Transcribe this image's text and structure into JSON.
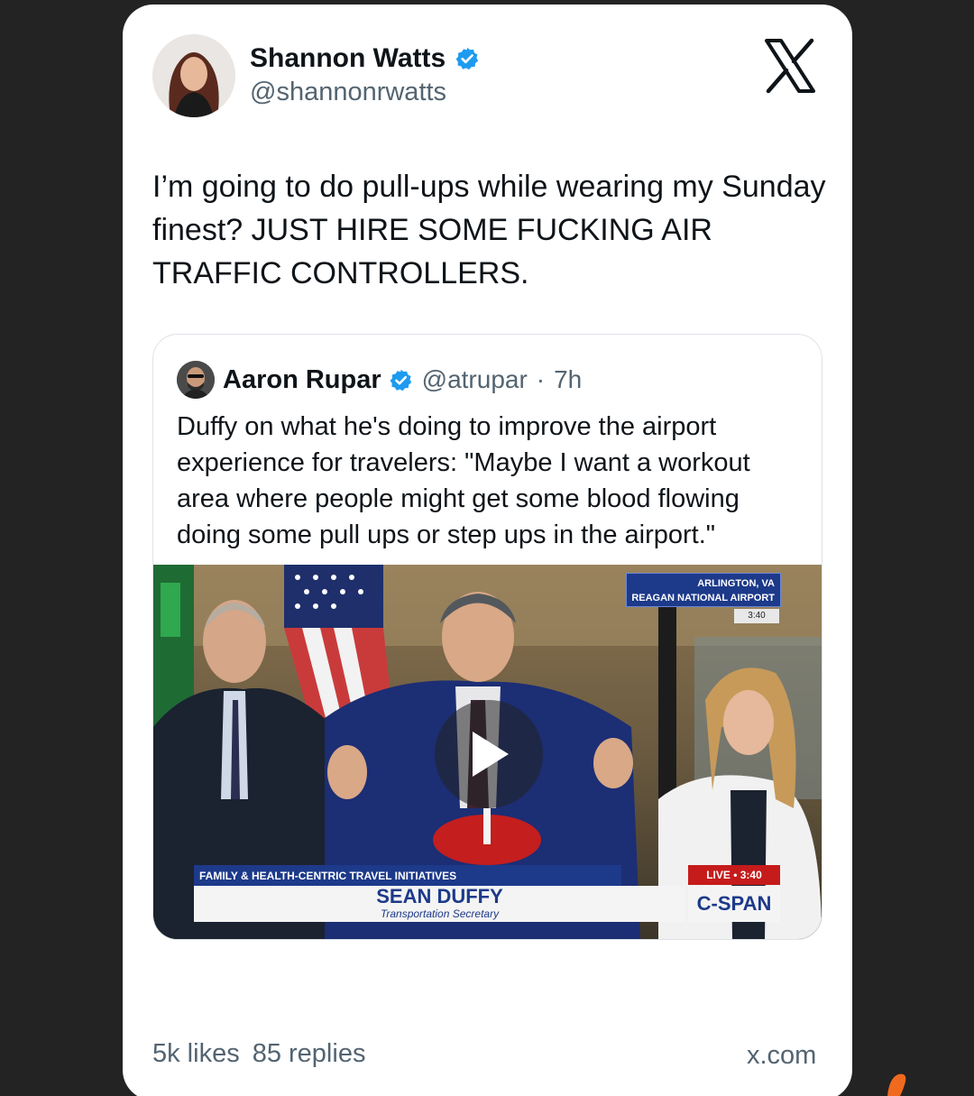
{
  "tweet": {
    "author_name": "Shannon Watts",
    "author_handle": "@shannonrwatts",
    "text": "I’m going to do pull-ups while wearing my Sunday finest? JUST HIRE SOME FUCKING AIR TRAFFIC CONTROLLERS.",
    "verified": true,
    "platform_icon": "x-logo-icon"
  },
  "quote": {
    "author_name": "Aaron Rupar",
    "author_handle": "@atrupar",
    "separator": "·",
    "time": "7h",
    "text": "Duffy on what he's doing to improve the airport experience for travelers: \"Maybe I want a workout area where people might get some blood flowing doing some pull ups or step ups in the airport.\"",
    "verified": true
  },
  "video": {
    "location_line1": "ARLINGTON, VA",
    "location_line2": "REAGAN NATIONAL AIRPORT",
    "location_time": "3:40",
    "lower_third_topic": "FAMILY & HEALTH-CENTRIC TRAVEL INITIATIVES",
    "speaker_name": "SEAN DUFFY",
    "speaker_title": "Transportation Secretary",
    "live_label": "LIVE • 3:40",
    "network": "C-SPAN",
    "play_icon": "play-icon"
  },
  "footer": {
    "likes": "5k likes",
    "replies": "85 replies",
    "domain": "x.com"
  },
  "colors": {
    "background": "#232323",
    "card": "#ffffff",
    "verified_blue": "#1d9bf0",
    "muted_text": "#536471",
    "cspan_blue": "#1d3a8a",
    "live_red": "#c61b1b"
  }
}
